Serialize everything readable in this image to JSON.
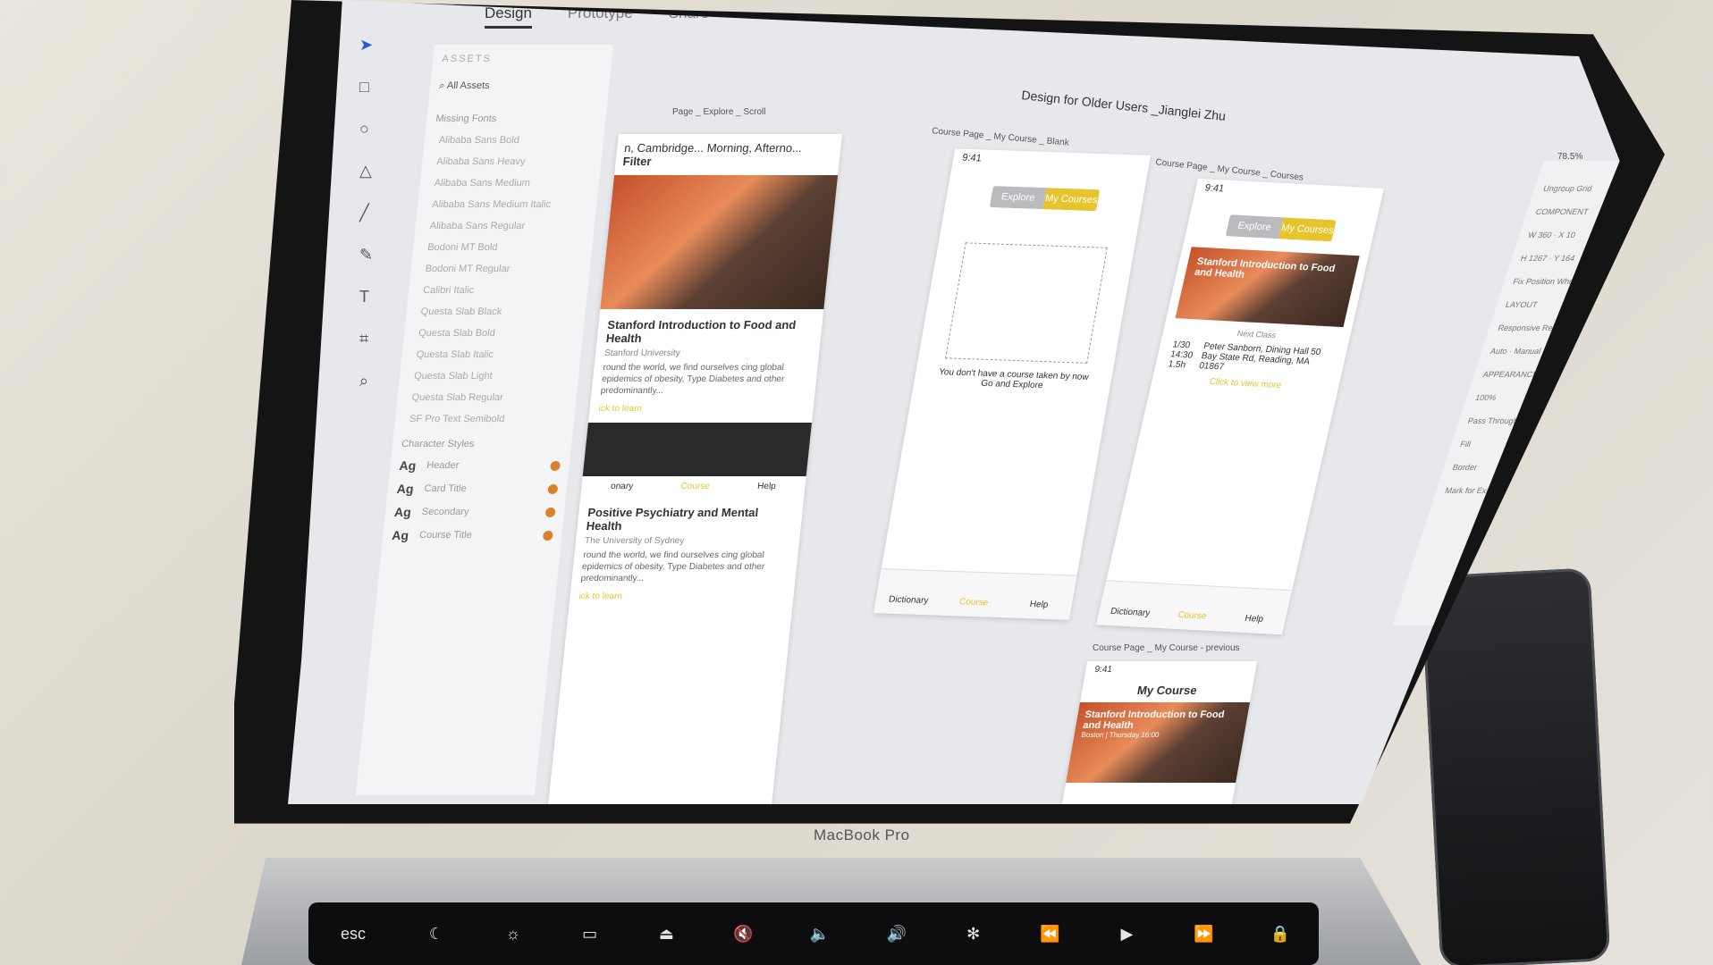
{
  "xd": {
    "tabs": [
      "Design",
      "Prototype",
      "Share"
    ],
    "doc_title": "Design for Older Users _Jianglei Zhu",
    "zoom": "78.5%",
    "assets": {
      "header": "ASSETS",
      "search": "All Assets",
      "missing_fonts_label": "Missing Fonts",
      "fonts": [
        "Alibaba Sans Bold",
        "Alibaba Sans Heavy",
        "Alibaba Sans Medium",
        "Alibaba Sans Medium Italic",
        "Alibaba Sans Regular",
        "Bodoni MT Bold",
        "Bodoni MT Regular",
        "Calibri Italic",
        "Questa Slab Black",
        "Questa Slab Bold",
        "Questa Slab Italic",
        "Questa Slab Light",
        "Questa Slab Regular",
        "SF Pro Text Semibold"
      ],
      "char_styles_label": "Character Styles",
      "char_styles": [
        {
          "ag": "Ag",
          "name": "Header"
        },
        {
          "ag": "Ag",
          "name": "Card Title"
        },
        {
          "ag": "Ag",
          "name": "Secondary"
        },
        {
          "ag": "Ag",
          "name": "Course Title"
        }
      ]
    },
    "artboard_left": {
      "label": "Page _ Explore _ Scroll",
      "filter_bar": "n, Cambridge... Morning, Afterno...",
      "filter": "Filter",
      "card1_title": "Stanford Introduction to Food and Health",
      "card1_uni": "Stanford University",
      "card1_desc": "round the world, we find ourselves cing global epidemics of obesity, Type Diabetes and other predominantly...",
      "card1_link": "ick to learn",
      "card2_title": "Positive Psychiatry and Mental Health",
      "card2_uni": "The University of Sydney",
      "card2_desc": "round the world, we find ourselves cing global epidemics of obesity, Type Diabetes and other predominantly...",
      "card2_link": "ick to learn",
      "tab_dictionary": "onary",
      "tab_course": "Course",
      "tab_help": "Help"
    },
    "artboard_mid": {
      "label": "Course Page _ My Course _ Blank",
      "time": "9:41",
      "seg_explore": "Explore",
      "seg_my": "My Courses",
      "empty_msg": "You don't have a course taken by now Go and Explore",
      "tab_dictionary": "Dictionary",
      "tab_course": "Course",
      "tab_help": "Help"
    },
    "artboard_right": {
      "label": "Course Page _ My Course _ Courses",
      "time": "9:41",
      "seg_explore": "Explore",
      "seg_my": "My Courses",
      "course_title": "Stanford Introduction to Food and Health",
      "next_class": "Next Class",
      "date": "1/30",
      "time_slot": "14:30",
      "duration": "1.5h",
      "location": "Peter Sanborn, Dining Hall 50 Bay State Rd, Reading, MA 01867",
      "link": "Click to view more",
      "tab_dictionary": "Dictionary",
      "tab_course": "Course",
      "tab_help": "Help"
    },
    "artboard_bottom": {
      "label": "Course Page _ My Course - previous",
      "time": "9:41",
      "title": "My Course",
      "card_title": "Stanford Introduction to Food and Health",
      "card_sub": "Boston | Thursday 16:00"
    },
    "right_panel": {
      "ungroup": "Ungroup Grid",
      "component": "COMPONENT",
      "w": "W 360",
      "x": "X 10",
      "h": "H 1267",
      "y": "Y 164",
      "fix_position": "Fix Position When Scrolling",
      "layout": "LAYOUT",
      "responsive_resize": "Responsive Resize",
      "auto": "Auto",
      "manual": "Manual",
      "appearance": "APPEARANCE",
      "opacity": "100%",
      "blend": "Pass Through",
      "fill": "Fill",
      "border": "Border",
      "mark_export": "Mark for Export"
    }
  },
  "bezel": {
    "label": "MacBook Pro"
  },
  "touchbar": {
    "keys": [
      "esc",
      "☾",
      "☼",
      "▭",
      "⏏",
      "🔇",
      "🔈",
      "🔊",
      "✻",
      "⏪",
      "▶",
      "⏩",
      "🔒"
    ]
  },
  "colors": {
    "accent": "#e6c42e",
    "selection": "#2a5bd7"
  }
}
